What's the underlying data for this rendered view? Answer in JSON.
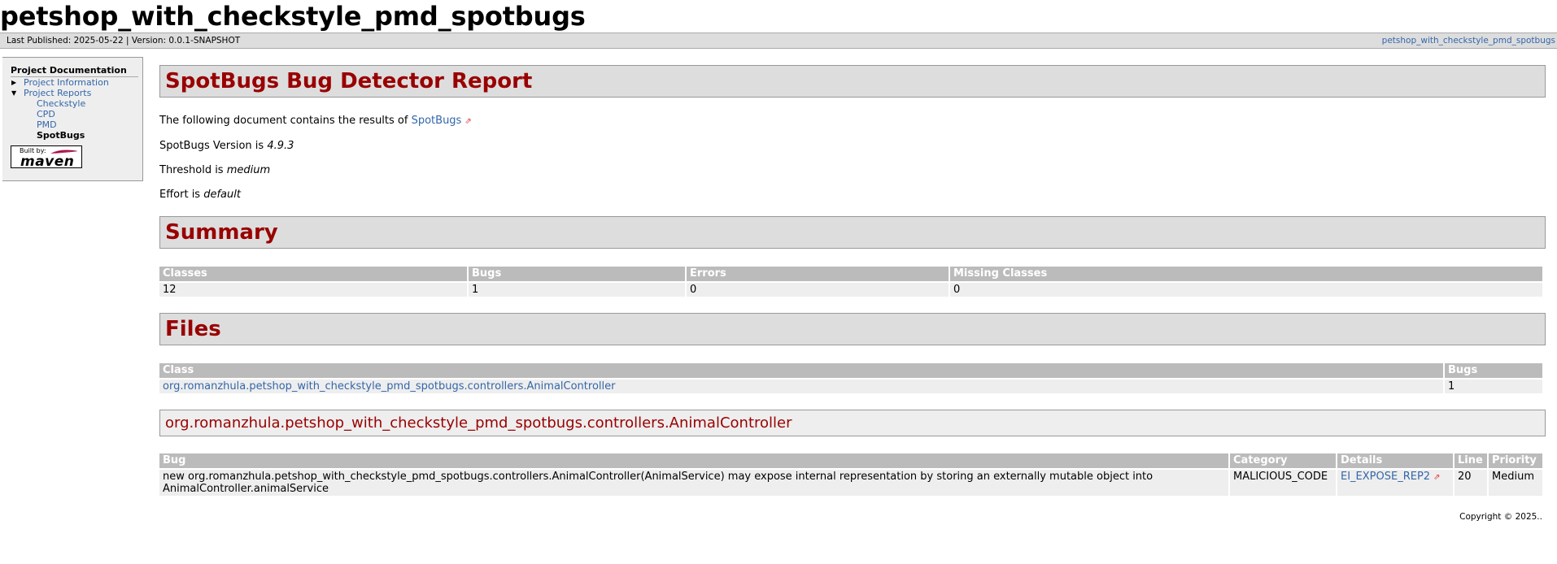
{
  "banner": {
    "title": "petshop_with_checkstyle_pmd_spotbugs"
  },
  "breadcrumbs": {
    "left": "Last Published: 2025-05-22 | Version: 0.0.1-SNAPSHOT",
    "right": "petshop_with_checkstyle_pmd_spotbugs"
  },
  "sidebar": {
    "heading": "Project Documentation",
    "items": [
      {
        "label": "Project Information"
      },
      {
        "label": "Project Reports"
      }
    ],
    "sub_items": [
      {
        "label": "Checkstyle"
      },
      {
        "label": "CPD"
      },
      {
        "label": "PMD"
      },
      {
        "label": "SpotBugs"
      }
    ],
    "badge": {
      "built_by": "Built by:",
      "name": "maven"
    }
  },
  "main": {
    "title": "SpotBugs Bug Detector Report",
    "intro_prefix": "The following document contains the results of ",
    "intro_link": "SpotBugs",
    "version_prefix": "SpotBugs Version is ",
    "version_value": "4.9.3",
    "threshold_prefix": "Threshold is ",
    "threshold_value": "medium",
    "effort_prefix": "Effort is ",
    "effort_value": "default",
    "summary": {
      "title": "Summary",
      "headers": [
        "Classes",
        "Bugs",
        "Errors",
        "Missing Classes"
      ],
      "row": [
        "12",
        "1",
        "0",
        "0"
      ]
    },
    "files": {
      "title": "Files",
      "headers": [
        "Class",
        "Bugs"
      ],
      "row": [
        "org.romanzhula.petshop_with_checkstyle_pmd_spotbugs.controllers.AnimalController",
        "1"
      ]
    },
    "class_section": {
      "title": "org.romanzhula.petshop_with_checkstyle_pmd_spotbugs.controllers.AnimalController",
      "headers": [
        "Bug",
        "Category",
        "Details",
        "Line",
        "Priority"
      ],
      "row": {
        "bug": "new org.romanzhula.petshop_with_checkstyle_pmd_spotbugs.controllers.AnimalController(AnimalService) may expose internal representation by storing an externally mutable object into AnimalController.animalService",
        "category": "MALICIOUS_CODE",
        "details": "EI_EXPOSE_REP2",
        "line": "20",
        "priority": "Medium"
      }
    }
  },
  "footer": {
    "copyright": "Copyright © 2025.."
  },
  "colors": {
    "heading_red": "#990000",
    "link_blue": "#3366aa",
    "header_gray": "#bbbbbb"
  }
}
